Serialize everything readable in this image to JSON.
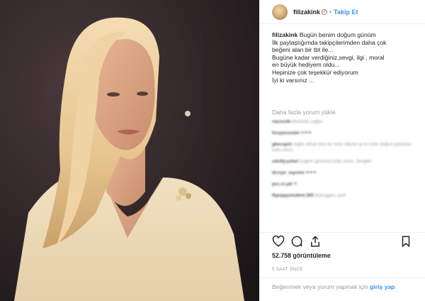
{
  "header": {
    "username": "filizakink",
    "verified_mark": "✓",
    "separator": "•",
    "follow_label": "Takip Et"
  },
  "caption": {
    "username": "filizakink",
    "lines": [
      "Bugün benim doğum günüm",
      "İlk paylaştığımda takipçilerimden daha çok",
      "beğeni alan bir tbt ile...",
      "Bugüne kadar verdiğiniz,sevgi, ilgi , moral",
      "en büyük hediyem oldu...",
      "Hepinize çok teşekkür ediyorum",
      "İyi ki varsınız ..."
    ]
  },
  "load_more_label": "Daha fazla yorum yükle",
  "comments": [
    {
      "user": "nazzoufe",
      "text": "Mutlululu çağlar"
    },
    {
      "user": "liccpasssedo",
      "text": "❤❤❤"
    },
    {
      "user": "gbocapot",
      "text": "sağlık ahhat dolu bir ömür dilerim iyi ki sizler doğum gününüz kutlu olsun"
    },
    {
      "user": "sdcilly.yohel",
      "text": "Doğum gününüz kutlu olsun, Sevgiler"
    },
    {
      "user": "dcrzye_sayolse",
      "text": "❤❤❤"
    },
    {
      "user": "pcc.cc.pd",
      "text": "❤"
    },
    {
      "user": "fkpoppystudent.365",
      "text": "Mutluggen, yarif"
    }
  ],
  "actions": {
    "like_icon": "heart-icon",
    "comment_icon": "comment-icon",
    "share_icon": "share-icon",
    "save_icon": "bookmark-icon"
  },
  "likes_label": "52.758 görüntüleme",
  "time_label": "5 SAAT ÖNCE",
  "footer": {
    "text": "Beğenmek veya yorum yapmak için ",
    "login_label": "giriş yap",
    "end": "."
  },
  "colors": {
    "link_blue": "#3897f0",
    "text": "#262626",
    "muted": "#999999",
    "border": "#efefef"
  }
}
